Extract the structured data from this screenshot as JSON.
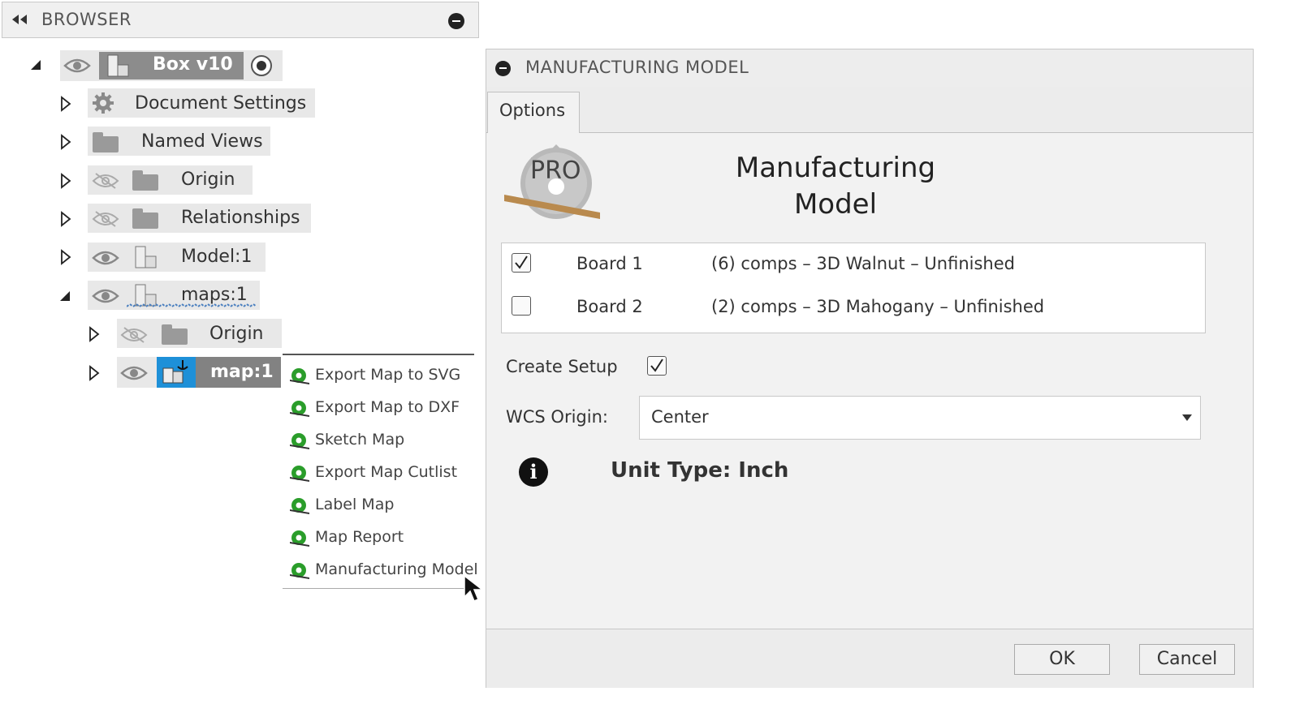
{
  "browser": {
    "title": "BROWSER"
  },
  "tree": {
    "root_label": "Box v10",
    "items": [
      {
        "label": "Document Settings"
      },
      {
        "label": "Named Views"
      },
      {
        "label": "Origin"
      },
      {
        "label": "Relationships"
      },
      {
        "label": "Model:1"
      },
      {
        "label": "maps:1"
      },
      {
        "label": "Origin"
      },
      {
        "label": "map:1"
      }
    ]
  },
  "context_menu": {
    "items": [
      {
        "label": "Export Map to SVG"
      },
      {
        "label": "Export Map to DXF"
      },
      {
        "label": "Sketch Map"
      },
      {
        "label": "Export Map Cutlist"
      },
      {
        "label": "Label Map"
      },
      {
        "label": "Map Report"
      },
      {
        "label": "Manufacturing Model"
      }
    ]
  },
  "dialog": {
    "title": "MANUFACTURING MODEL",
    "tab": "Options",
    "logo_text": "PRO",
    "heading_line1": "Manufacturing",
    "heading_line2": "Model",
    "boards": [
      {
        "checked": true,
        "name": "Board 1",
        "description": "(6) comps – 3D Walnut – Unfinished"
      },
      {
        "checked": false,
        "name": "Board 2",
        "description": "(2) comps – 3D Mahogany – Unfinished"
      }
    ],
    "create_setup_label": "Create Setup",
    "create_setup_checked": true,
    "wcs_label": "WCS Origin:",
    "wcs_value": "Center",
    "info_glyph": "i",
    "unit_type": "Unit Type: Inch",
    "ok_label": "OK",
    "cancel_label": "Cancel"
  },
  "colors": {
    "selection_blue": "#1e90d8",
    "selection_gray": "#828282",
    "menu_icon_green": "#2a9d2a"
  }
}
